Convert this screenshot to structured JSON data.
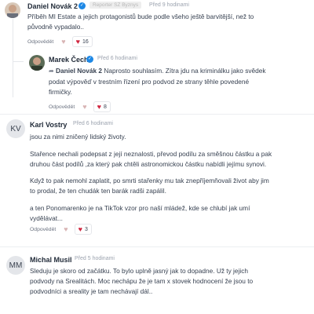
{
  "comments": [
    {
      "name": "Daniel Novák 2",
      "badge": "Reporter SZ Byznys",
      "time": "Před 9 hodinami",
      "body": [
        "Příběh MI Estate a jejich protagonistů bude podle všeho ještě barvitější, než to",
        "původně vypadalo.."
      ],
      "reply_label": "Odpovědět",
      "likes": "16",
      "verified": true
    },
    {
      "name": "Marek Čech",
      "time": "Před 6 hodinami",
      "mention": "Daniel Novák 2",
      "body_after_mention": " Naprosto souhlasím. Zítra jdu na kriminálku jako svědek",
      "body": [
        "podat výpověď v trestním řízení pro podvod ze strany těhle povedené",
        "firmičky."
      ],
      "reply_label": "Odpovědět",
      "likes": "8",
      "verified": true
    },
    {
      "name": "Karl Vostry",
      "initials": "KV",
      "time": "Před 6 hodinami",
      "paragraphs": [
        [
          "jsou za nimi zničený lidský životy."
        ],
        [
          "Stařence nechali podepsat z její neznalosti, převod podílu za směšnou částku a pak",
          "druhou část podílů ,za který pak chtěli astronomickou částku nabídli jejímu synovi."
        ],
        [
          "Když to pak nemohl zaplatit, po smrti stařenky mu tak znepříjemňovali život aby jim",
          "to prodal, že ten chudák ten barák radši zapálil."
        ],
        [
          "a ten Ponomarenko je na TikTok vzor pro naší mládež, kde se chlubí jak umí",
          "vydělávat..."
        ]
      ],
      "reply_label": "Odpovědět",
      "likes": "3"
    },
    {
      "name": "Michal Musil",
      "initials": "MM",
      "time": "Před 5 hodinami",
      "body": [
        "Sleduju je skoro od začátku. To bylo uplně jasný jak to dopadne. Už ty jejich",
        "podvody na Srealitách. Moc nechápu že je tam x stovek hodnocení že jsou to",
        "podvodníci a sreality je tam nechávají dál.."
      ]
    }
  ],
  "colors": {
    "heart": "#d0253f",
    "verified": "#1e88e5",
    "separator": "#eceef1"
  }
}
